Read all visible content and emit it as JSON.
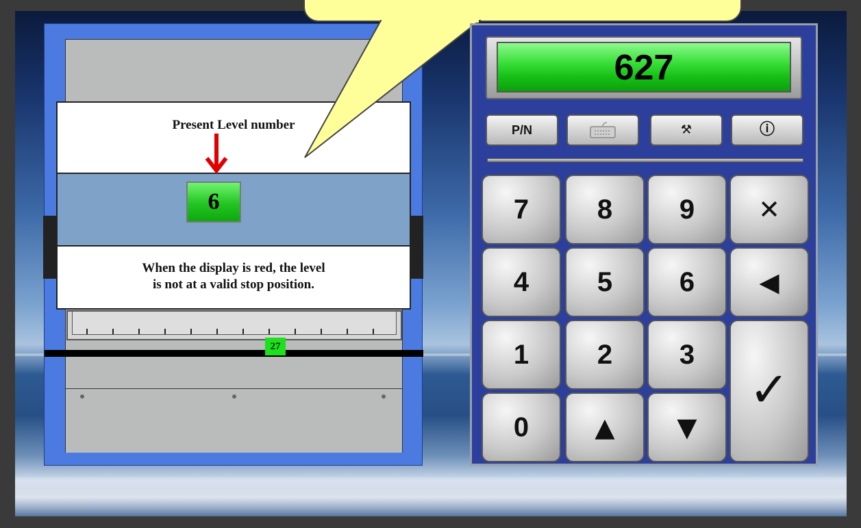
{
  "bubble": {
    "text": ""
  },
  "machine": {
    "banner_top": "Present Level number",
    "level_value": "6",
    "banner_bottom_line1": "When the display is red, the level",
    "banner_bottom_line2": "is not at a valid stop position.",
    "position_value": "27",
    "level_color": "#1ee01e"
  },
  "keypad": {
    "display_value": "627",
    "function_buttons": [
      {
        "label": "P/N",
        "icon": "text"
      },
      {
        "label": "",
        "icon": "keyboard-icon"
      },
      {
        "label": "⚒",
        "icon": "tools-icon"
      },
      {
        "label": "ⓘ",
        "icon": "info-icon"
      }
    ],
    "keys": {
      "k7": "7",
      "k8": "8",
      "k9": "9",
      "clear": "✕",
      "k4": "4",
      "k5": "5",
      "k6": "6",
      "back": "◀",
      "k1": "1",
      "k2": "2",
      "k3": "3",
      "enter": "✓",
      "k0": "0",
      "up": "▲",
      "down": "▼"
    }
  }
}
